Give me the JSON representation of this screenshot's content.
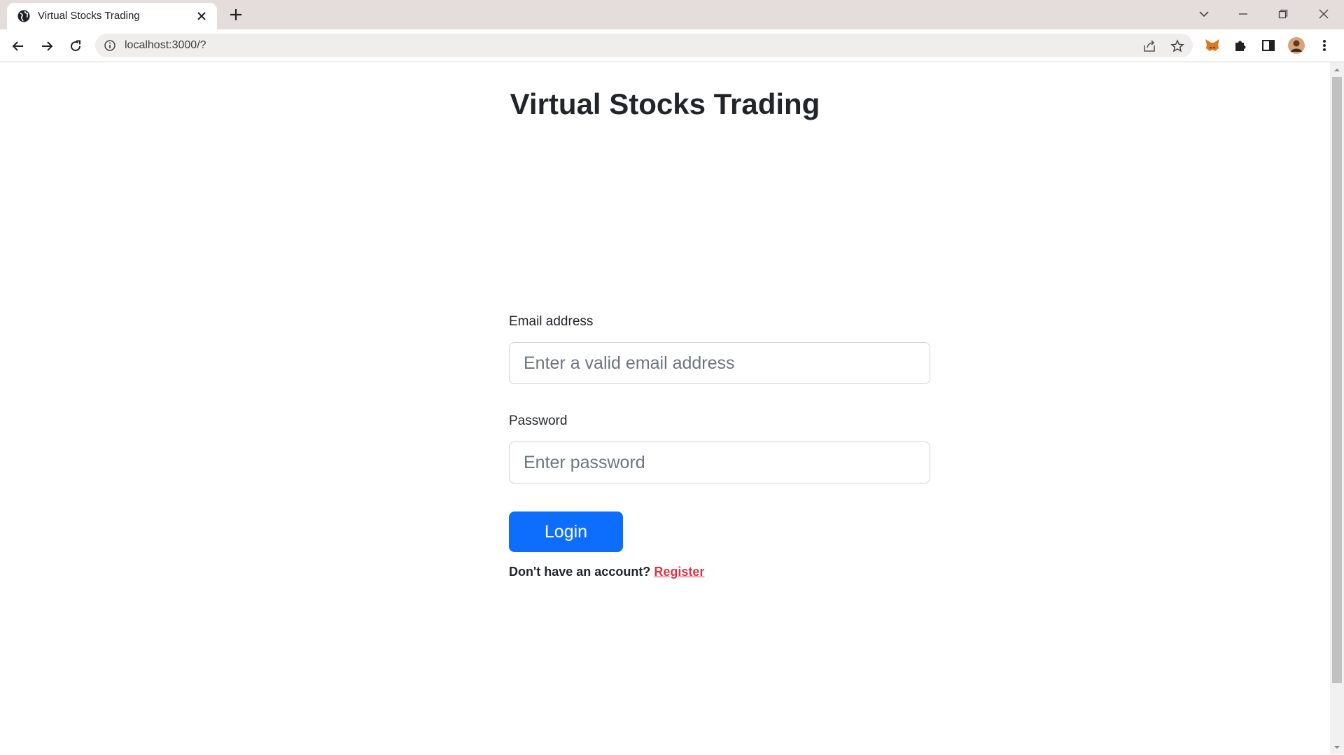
{
  "browser": {
    "tab": {
      "title": "Virtual Stocks Trading",
      "icon": "globe-icon"
    },
    "address_bar": {
      "url": "localhost:3000/?"
    }
  },
  "page": {
    "title": "Virtual Stocks Trading",
    "form": {
      "email_label": "Email address",
      "email_placeholder": "Enter a valid email address",
      "email_value": "",
      "password_label": "Password",
      "password_placeholder": "Enter password",
      "password_value": "",
      "login_label": "Login",
      "signup_prompt": "Don't have an account?",
      "register_label": "Register"
    }
  },
  "colors": {
    "primary_button": "#0d6efd",
    "register_link": "#dc3545",
    "tab_strip": "#e5dcdc"
  }
}
